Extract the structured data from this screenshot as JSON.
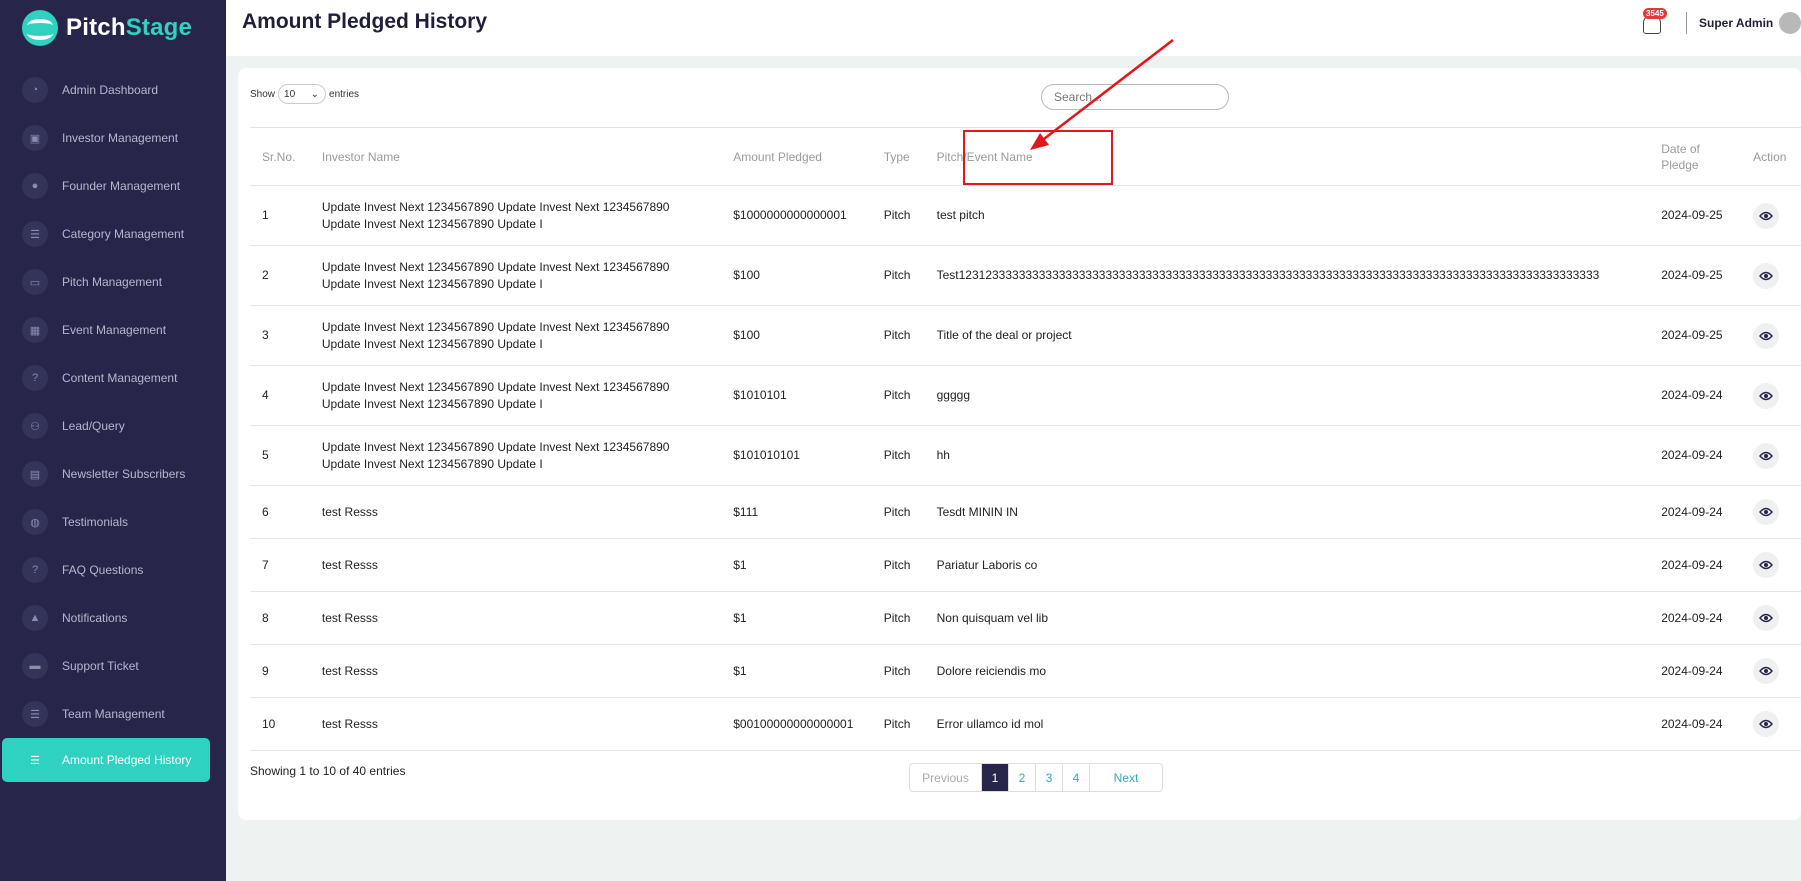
{
  "brand": {
    "name_part1": "Pitch",
    "name_part2": "Stage"
  },
  "sidebar": {
    "items": [
      {
        "label": "Admin Dashboard",
        "icon": "dashboard-icon"
      },
      {
        "label": "Investor Management",
        "icon": "investor-icon"
      },
      {
        "label": "Founder Management",
        "icon": "bulb-icon"
      },
      {
        "label": "Category Management",
        "icon": "list-icon"
      },
      {
        "label": "Pitch Management",
        "icon": "presentation-icon"
      },
      {
        "label": "Event Management",
        "icon": "calendar-icon"
      },
      {
        "label": "Content Management",
        "icon": "question-icon"
      },
      {
        "label": "Lead/Query",
        "icon": "users-icon"
      },
      {
        "label": "Newsletter Subscribers",
        "icon": "newspaper-icon"
      },
      {
        "label": "Testimonials",
        "icon": "chat-icon"
      },
      {
        "label": "FAQ Questions",
        "icon": "question-icon"
      },
      {
        "label": "Notifications",
        "icon": "bell-icon"
      },
      {
        "label": "Support Ticket",
        "icon": "ticket-icon"
      },
      {
        "label": "Team Management",
        "icon": "list-icon"
      },
      {
        "label": "Amount Pledged History",
        "icon": "list-icon",
        "active": true
      }
    ]
  },
  "header": {
    "title": "Amount Pledged History",
    "notification_count": "3545",
    "user_name": "Super Admin"
  },
  "controls": {
    "show_label": "Show",
    "page_length": "10",
    "entries_label": "entries",
    "search_placeholder": "Search..."
  },
  "table": {
    "columns": [
      "Sr.No.",
      "Investor Name",
      "Amount Pledged",
      "Type",
      "Pitch/Event Name",
      "Date of Pledge",
      "Action"
    ],
    "rows": [
      {
        "sr": "1",
        "investor": "Update Invest Next 1234567890 Update Invest Next 1234567890 Update Invest Next 1234567890 Update I",
        "amount": "$1000000000000001",
        "type": "Pitch",
        "pitch": "test pitch",
        "date": "2024-09-25"
      },
      {
        "sr": "2",
        "investor": "Update Invest Next 1234567890 Update Invest Next 1234567890 Update Invest Next 1234567890 Update I",
        "amount": "$100",
        "type": "Pitch",
        "pitch": "Test123123333333333333333333333333333333333333333333333333333333333333333333333333333333333333333333",
        "date": "2024-09-25"
      },
      {
        "sr": "3",
        "investor": "Update Invest Next 1234567890 Update Invest Next 1234567890 Update Invest Next 1234567890 Update I",
        "amount": "$100",
        "type": "Pitch",
        "pitch": "Title of the deal or project",
        "date": "2024-09-25"
      },
      {
        "sr": "4",
        "investor": "Update Invest Next 1234567890 Update Invest Next 1234567890 Update Invest Next 1234567890 Update I",
        "amount": "$1010101",
        "type": "Pitch",
        "pitch": "ggggg",
        "date": "2024-09-24"
      },
      {
        "sr": "5",
        "investor": "Update Invest Next 1234567890 Update Invest Next 1234567890 Update Invest Next 1234567890 Update I",
        "amount": "$101010101",
        "type": "Pitch",
        "pitch": "hh",
        "date": "2024-09-24"
      },
      {
        "sr": "6",
        "investor": "test Resss",
        "amount": "$111",
        "type": "Pitch",
        "pitch": "Tesdt MININ IN",
        "date": "2024-09-24"
      },
      {
        "sr": "7",
        "investor": "test Resss",
        "amount": "$1",
        "type": "Pitch",
        "pitch": "Pariatur Laboris co",
        "date": "2024-09-24"
      },
      {
        "sr": "8",
        "investor": "test Resss",
        "amount": "$1",
        "type": "Pitch",
        "pitch": "Non quisquam vel lib",
        "date": "2024-09-24"
      },
      {
        "sr": "9",
        "investor": "test Resss",
        "amount": "$1",
        "type": "Pitch",
        "pitch": "Dolore reiciendis mo",
        "date": "2024-09-24"
      },
      {
        "sr": "10",
        "investor": "test Resss",
        "amount": "$00100000000000001",
        "type": "Pitch",
        "pitch": "Error ullamco id mol",
        "date": "2024-09-24"
      }
    ]
  },
  "footer": {
    "info": "Showing 1 to 10 of 40 entries",
    "prev_label": "Previous",
    "pages": [
      "1",
      "2",
      "3",
      "4"
    ],
    "current_page": "1",
    "next_label": "Next"
  },
  "colors": {
    "sidebar_bg": "#27264a",
    "accent": "#2fd1c0",
    "annotation": "#e0171b"
  }
}
